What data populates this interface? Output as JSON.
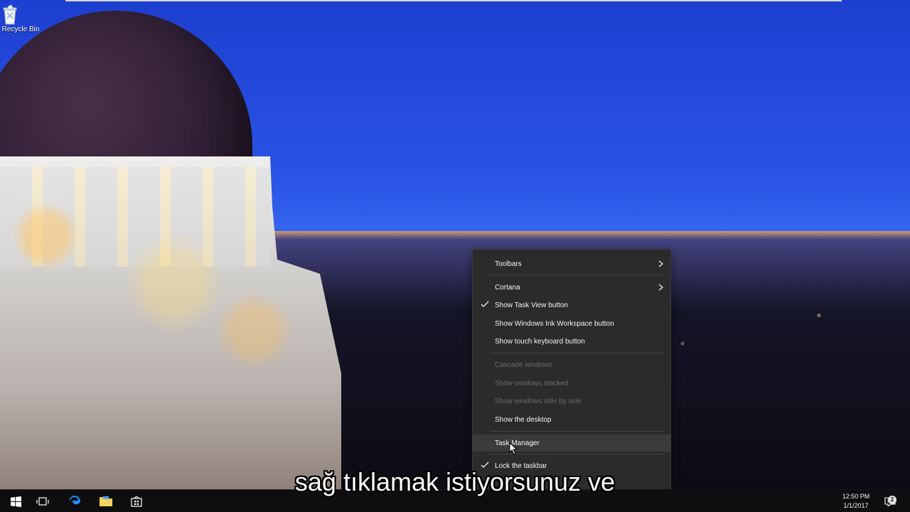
{
  "desktop": {
    "icons": [
      {
        "label": "Recycle Bin",
        "icon": "recycle-bin-icon"
      }
    ]
  },
  "context_menu": {
    "items": [
      {
        "label": "Toolbars",
        "checked": false,
        "enabled": true,
        "submenu": true
      },
      {
        "label": "Cortana",
        "checked": false,
        "enabled": true,
        "submenu": true
      },
      {
        "label": "Show Task View button",
        "checked": true,
        "enabled": true,
        "submenu": false
      },
      {
        "label": "Show Windows Ink Workspace button",
        "checked": false,
        "enabled": true,
        "submenu": false
      },
      {
        "label": "Show touch keyboard button",
        "checked": false,
        "enabled": true,
        "submenu": false
      },
      {
        "label": "Cascade windows",
        "checked": false,
        "enabled": false,
        "submenu": false
      },
      {
        "label": "Show windows stacked",
        "checked": false,
        "enabled": false,
        "submenu": false
      },
      {
        "label": "Show windows side by side",
        "checked": false,
        "enabled": false,
        "submenu": false
      },
      {
        "label": "Show the desktop",
        "checked": false,
        "enabled": true,
        "submenu": false
      },
      {
        "label": "Task Manager",
        "checked": false,
        "enabled": true,
        "submenu": false
      },
      {
        "label": "Lock the taskbar",
        "checked": true,
        "enabled": true,
        "submenu": false
      }
    ]
  },
  "taskbar": {
    "buttons": [
      {
        "icon": "windows-start-icon"
      },
      {
        "icon": "task-view-icon"
      },
      {
        "icon": "edge-browser-icon"
      },
      {
        "icon": "file-explorer-icon"
      },
      {
        "icon": "store-icon"
      }
    ],
    "tray": {
      "time": "12:50 PM",
      "date": "1/1/2017",
      "notifications_count": "2",
      "icons": [
        "chevron-up-icon",
        "network-icon",
        "volume-icon",
        "action-center-icon"
      ]
    }
  },
  "subtitle": {
    "text": "sağ tıklamak istiyorsunuz ve"
  },
  "colors": {
    "menu_bg": "#2b2b2b",
    "menu_text": "#f4f4f4",
    "menu_disabled": "#6c6c6c",
    "taskbar_bg": "#0e0e12",
    "accent_blue": "#1e90ff"
  }
}
